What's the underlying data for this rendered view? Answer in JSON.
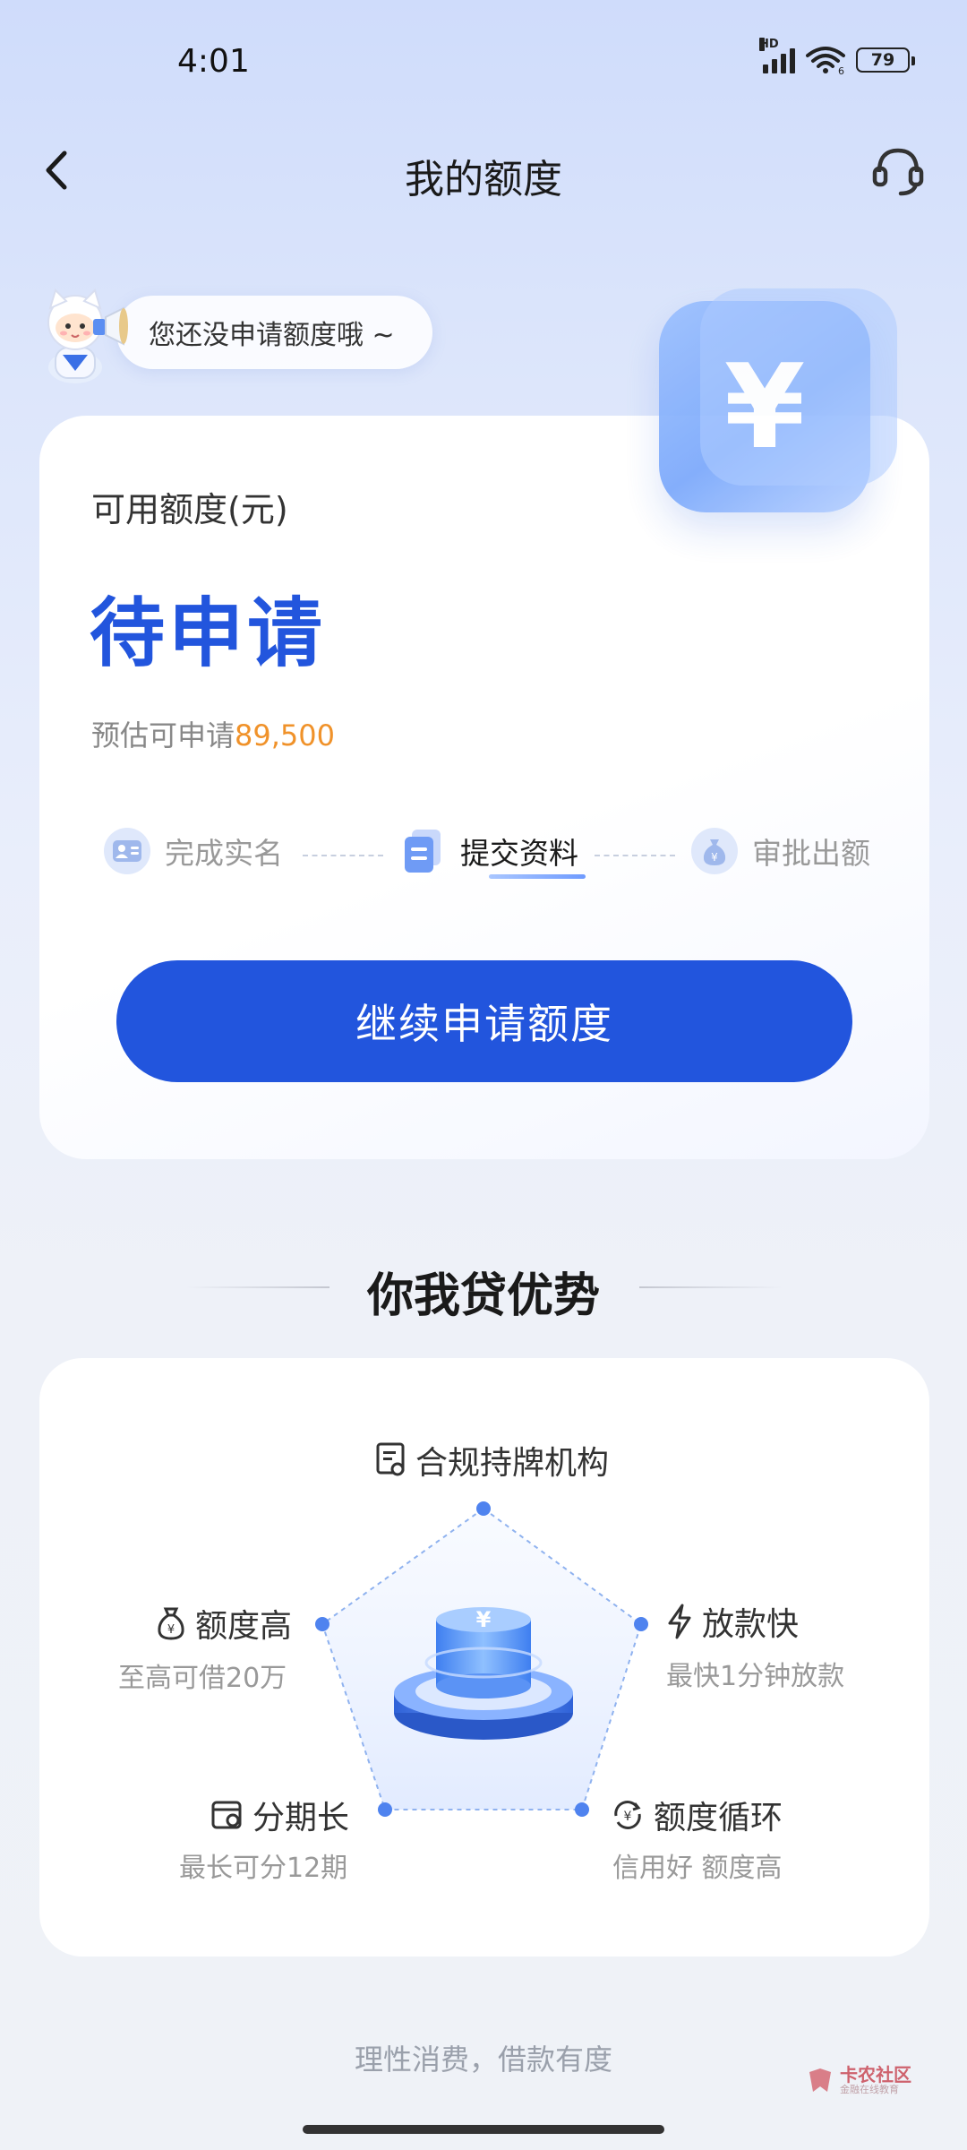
{
  "status_bar": {
    "time": "4:01",
    "hd_label": "HD",
    "wifi_sub": "6",
    "battery": "79"
  },
  "header": {
    "title": "我的额度"
  },
  "bubble": {
    "text": "您还没申请额度哦 ~"
  },
  "quota": {
    "label": "可用额度(元)",
    "status": "待申请",
    "estimate_prefix": "预估可申请",
    "estimate_amount": "89,500",
    "yen_symbol": "¥"
  },
  "steps": [
    {
      "label": "完成实名",
      "icon": "id-card-icon"
    },
    {
      "label": "提交资料",
      "icon": "document-icon"
    },
    {
      "label": "审批出额",
      "icon": "money-bag-icon"
    }
  ],
  "cta": {
    "label": "继续申请额度"
  },
  "advantages": {
    "title": "你我贷优势",
    "top": {
      "label": "合规持牌机构",
      "icon": "certificate-icon"
    },
    "left": {
      "label": "额度高",
      "sub": "至高可借20万",
      "icon": "money-bag-icon"
    },
    "right": {
      "label": "放款快",
      "sub": "最快1分钟放款",
      "icon": "lightning-icon"
    },
    "bottom_left": {
      "label": "分期长",
      "sub": "最长可分12期",
      "icon": "calendar-icon"
    },
    "bottom_right": {
      "label": "额度循环",
      "sub": "信用好 额度高",
      "icon": "cycle-yen-icon"
    }
  },
  "footer": {
    "note": "理性消费，借款有度"
  },
  "watermark": {
    "title": "卡农社区",
    "sub": "金融在线教育"
  },
  "colors": {
    "primary": "#2255dd",
    "accent_orange": "#f0922a",
    "card_bg": "#ffffff"
  }
}
